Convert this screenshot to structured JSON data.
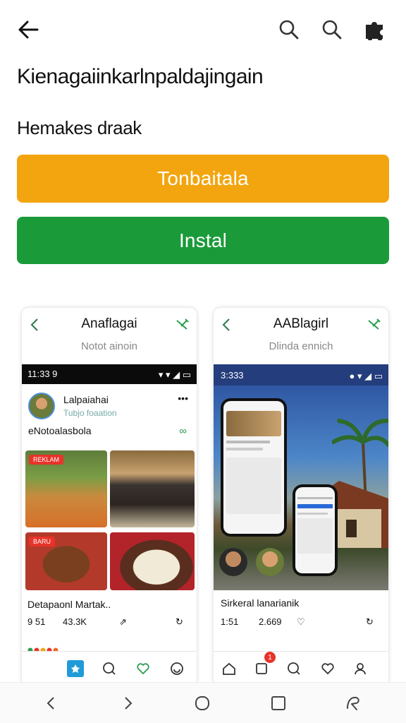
{
  "topbar": {
    "back_icon": "arrow-left-icon",
    "search_icon": "search-icon",
    "search2_icon": "search-icon",
    "profile_icon": "puzzle-icon"
  },
  "page": {
    "title": "Kienagaiinkarlnpaldajingain",
    "subtitle": "Hemakes draak",
    "orange_button": "Tonbaitala",
    "green_button": "Instal"
  },
  "colors": {
    "orange": "#f2a50f",
    "green": "#1b9a3a",
    "status_blue": "#243d7c"
  },
  "screenshot_left": {
    "title": "Anaflagai",
    "subtitle": "Notot ainoin",
    "status_time": "11:33 9",
    "user_name": "Lalpaiahai",
    "user_meta": "Tubjo foaation",
    "caption": "eNotoalasbola",
    "badge1": "REKLAM",
    "badge2": "BARU",
    "footer_title": "Detapaonl Martak..",
    "stats": [
      "9 51",
      "43.3K",
      "⇗",
      "↻"
    ]
  },
  "screenshot_right": {
    "title": "AABlagirl",
    "subtitle": "Dlinda ennich",
    "status_time": "3:333",
    "footer_title": "Sirkeral lanarianik",
    "stats": [
      "1:51",
      "2.669",
      "♡",
      "↻"
    ],
    "notification_badge": "1"
  },
  "sysnav": {
    "back": "chevron-left-icon",
    "forward": "chevron-right-icon",
    "home": "circle-icon",
    "recents": "square-icon",
    "assist": "assistant-icon"
  }
}
